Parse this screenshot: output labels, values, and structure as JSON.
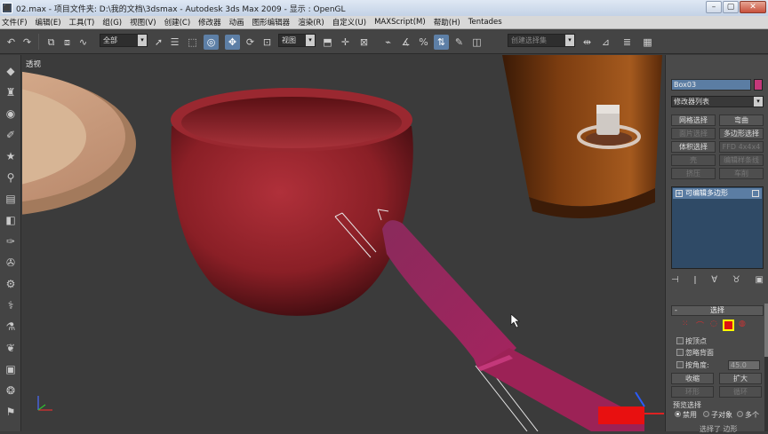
{
  "window": {
    "title": "02.max    - 项目文件夹: D:\\我的文档\\3dsmax    - Autodesk 3ds Max  2009    - 显示 : OpenGL",
    "app_icon_glyph": "⬛",
    "minimize": "–",
    "maximize": "▢",
    "close": "✕"
  },
  "menu": {
    "items": [
      "文件(F)",
      "编辑(E)",
      "工具(T)",
      "组(G)",
      "视图(V)",
      "创建(C)",
      "修改器",
      "动画",
      "图形编辑器",
      "渲染(R)",
      "自定义(U)",
      "MAXScript(M)",
      "帮助(H)",
      "Tentades"
    ]
  },
  "toolbar": {
    "filter_value": "全部",
    "refcoord_value": "视图",
    "named_sel_value": "创建选择集",
    "dropdown_arrow": "▾"
  },
  "viewport": {
    "label": "透视"
  },
  "command_panel": {
    "object_name": "Box03",
    "object_color": "#c4387a",
    "modifier_list": "修改器列表",
    "buttons": [
      {
        "label": "网格选择",
        "enabled": true
      },
      {
        "label": "弯曲",
        "enabled": true
      },
      {
        "label": "面片选择",
        "enabled": false
      },
      {
        "label": "多边形选择",
        "enabled": true
      },
      {
        "label": "体积选择",
        "enabled": true
      },
      {
        "label": "FFD 4x4x4",
        "enabled": false
      },
      {
        "label": "壳",
        "enabled": false
      },
      {
        "label": "编辑样条线",
        "enabled": false
      },
      {
        "label": "挤压",
        "enabled": false
      },
      {
        "label": "车削",
        "enabled": false
      }
    ],
    "stack_item": "可编辑多边形",
    "stack_plus": "+",
    "rollout_title": "选择",
    "rollout_minus": "-",
    "checkbox_by_vertex": "按顶点",
    "checkbox_ignore_backface": "忽略背面",
    "checkbox_by_angle": "按角度:",
    "angle_value": "45.0",
    "shrink": "收缩",
    "grow": "扩大",
    "ring": "环形",
    "loop": "循环",
    "preview_title": "预览选择",
    "preview_options": [
      "禁用",
      "子对象",
      "多个"
    ],
    "preview_selected": 0,
    "bottom_text": "选择了 边形"
  }
}
